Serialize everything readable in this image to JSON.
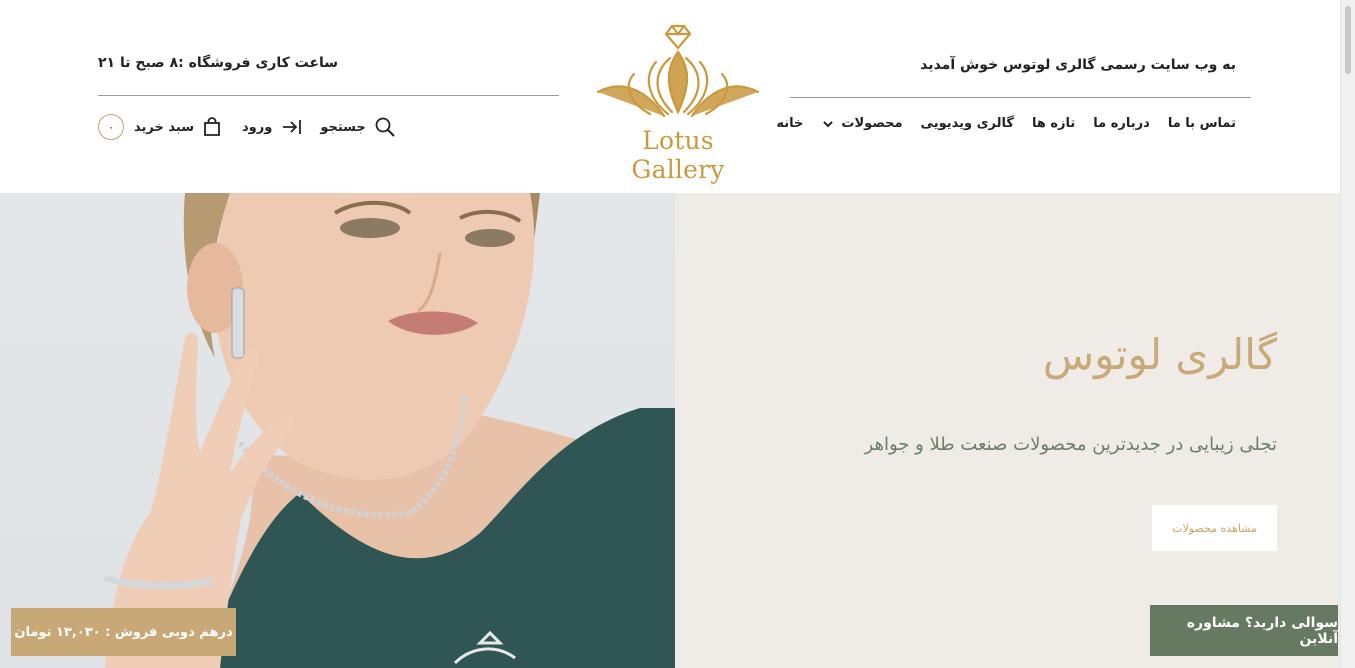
{
  "header": {
    "welcome": "به وب سایت رسمی گالری لوتوس خوش آمدید",
    "hours": "ساعت کاری فروشگاه :۸ صبح تا ۲۱",
    "logo_text": "Lotus Gallery"
  },
  "nav": {
    "items": [
      {
        "label": "خانه"
      },
      {
        "label": "محصولات"
      },
      {
        "label": "گالری ویدیویی"
      },
      {
        "label": "تازه ها"
      },
      {
        "label": "درباره ما"
      },
      {
        "label": "تماس با ما"
      }
    ]
  },
  "tools": {
    "search_label": "جستجو",
    "login_label": "ورود",
    "cart_label": "سبد خرید",
    "cart_count": "۰"
  },
  "hero": {
    "title": "گالری لوتوس",
    "subtitle": "تجلی زیبایی در جدیدترین محصولات صنعت طلا و جواهر",
    "button": "مشاهده محصولات"
  },
  "badges": {
    "price": "درهم دوبی فروش : ۱۳,۰۳۰ تومان",
    "chat": "سوالی دارید؟ مشاوره آنلاین"
  },
  "colors": {
    "gold": "#c8a26a",
    "hero_bg": "#efece8",
    "chat_green": "#657a60"
  }
}
